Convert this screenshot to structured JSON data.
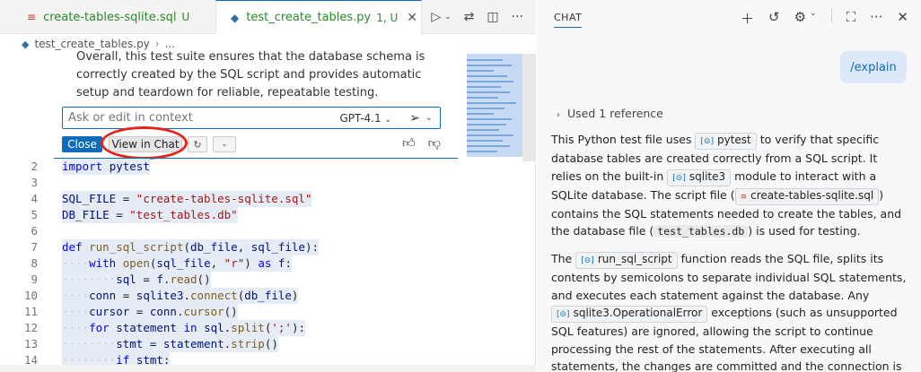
{
  "tabs": [
    {
      "label": "create-tables-sqlite.sql",
      "badge": "U"
    },
    {
      "label": "test_create_tables.py",
      "badge": "1, U"
    }
  ],
  "breadcrumb": {
    "file": "test_create_tables.py",
    "more": "..."
  },
  "inline_chat": {
    "summary": "Overall, this test suite ensures that the database schema is correctly created by the SQL script and provides automatic setup and teardown for reliable, repeatable testing.",
    "input_placeholder": "Ask or edit in context",
    "model": "GPT-4.1",
    "close_label": "Close",
    "view_in_chat_label": "View in Chat"
  },
  "code_lines": [
    {
      "n": "2",
      "html": "<span class='kw'>import</span> <span class='var'>pytest</span>"
    },
    {
      "n": "3",
      "html": ""
    },
    {
      "n": "4",
      "html": "<span class='var'>SQL_FILE</span> = <span class='str'>\"create-tables-sqlite.sql\"</span>"
    },
    {
      "n": "5",
      "html": "<span class='var'>DB_FILE</span> = <span class='str'>\"test_tables.db\"</span>"
    },
    {
      "n": "6",
      "html": ""
    },
    {
      "n": "7",
      "html": "<span class='kw'>def</span> <span class='fn'>run_sql_script</span>(<span class='var'>db_file</span>, <span class='var'>sql_file</span>):"
    },
    {
      "n": "8",
      "html": "<span class='dots'>····</span><span class='kw'>with</span> <span class='fn'>open</span>(<span class='var'>sql_file</span>, <span class='str'>\"r\"</span>) <span class='kw'>as</span> <span class='var'>f</span>:"
    },
    {
      "n": "9",
      "html": "<span class='dots'>········</span><span class='var'>sql</span> = <span class='var'>f</span>.<span class='fn'>read</span>()"
    },
    {
      "n": "10",
      "html": "<span class='dots'>····</span><span class='var'>conn</span> = <span class='var'>sqlite3</span>.<span class='fn'>connect</span>(<span class='var'>db_file</span>)"
    },
    {
      "n": "11",
      "html": "<span class='dots'>····</span><span class='var'>cursor</span> = <span class='var'>conn</span>.<span class='fn'>cursor</span>()"
    },
    {
      "n": "12",
      "html": "<span class='dots'>····</span><span class='kw'>for</span> <span class='var'>statement</span> <span class='kw'>in</span> <span class='var'>sql</span>.<span class='fn'>split</span>(<span class='str'>';'</span>):"
    },
    {
      "n": "13",
      "html": "<span class='dots'>········</span><span class='var'>stmt</span> = <span class='var'>statement</span>.<span class='fn'>strip</span>()"
    },
    {
      "n": "14",
      "html": "<span class='dots'>········</span><span class='kw'>if</span> <span class='var'>stmt</span>:"
    }
  ],
  "chat": {
    "title": "CHAT",
    "user_message": "/explain",
    "used_reference": "Used 1 reference",
    "p1": {
      "t1": "This Python test file uses ",
      "pytest": "pytest",
      "t2": " to verify that specific database tables are created correctly from a SQL script. It relies on the built-in ",
      "sqlite3": "sqlite3",
      "t3": " module to interact with a SQLite database. The script file (",
      "sqlfile": "create-tables-sqlite.sql",
      "t4": ") contains the SQL statements needed to create the tables, and the database file (",
      "dbfile": "test_tables.db",
      "t5": ") is used for testing."
    },
    "p2": {
      "t1": "The ",
      "fn": "run_sql_script",
      "t2": " function reads the SQL file, splits its contents by semicolons to separate individual SQL statements, and executes each statement against the database. Any ",
      "err": "sqlite3.OperationalError",
      "t3": " exceptions (such as unsupported SQL features) are ignored, allowing the script to continue processing the rest of the statements. After executing all statements, the changes are committed and the connection is"
    }
  }
}
